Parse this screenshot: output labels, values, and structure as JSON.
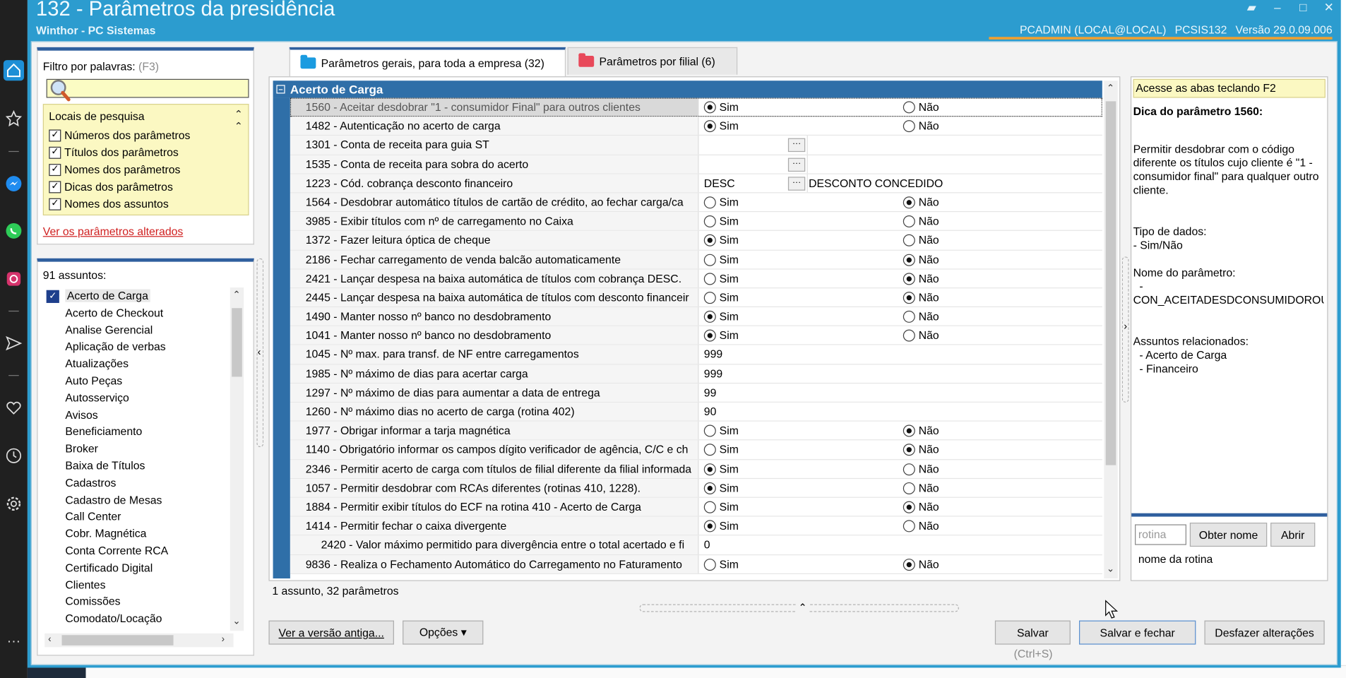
{
  "window": {
    "title": "132 - Parâmetros da presidência",
    "subtitle": "Winthor - PC Sistemas",
    "user": "PCADMIN (LOCAL@LOCAL)",
    "routine": "PCSIS132",
    "version": "Versão  29.0.09.006"
  },
  "filter": {
    "label": "Filtro por palavras:",
    "hint": "(F3)",
    "value": "",
    "locais_title": "Locais de pesquisa",
    "options": [
      {
        "label": "Números dos parâmetros",
        "checked": true
      },
      {
        "label": "Títulos dos parâmetros",
        "checked": true
      },
      {
        "label": "Nomes dos parâmetros",
        "checked": true
      },
      {
        "label": "Dicas dos parâmetros",
        "checked": true
      },
      {
        "label": "Nomes dos assuntos",
        "checked": true
      }
    ],
    "changed_link": "Ver os parâmetros alterados"
  },
  "assuntos": {
    "count_label": "91 assuntos:",
    "items": [
      "Acerto de Carga",
      "Acerto de Checkout",
      "Analise Gerencial",
      "Aplicação de verbas",
      "Atualizações",
      "Auto Peças",
      "Autosserviço",
      "Avisos",
      "Beneficiamento",
      "Broker",
      "Baixa de Títulos",
      "Cadastros",
      "Cadastro de Mesas",
      "Call Center",
      "Cobr. Magnética",
      "Conta Corrente RCA",
      "Certificado Digital",
      "Clientes",
      "Comissões",
      "Comodato/Locação"
    ]
  },
  "tabs": [
    {
      "label": "Parâmetros gerais, para toda a empresa  (32)",
      "color": "#1a9be0"
    },
    {
      "label": "Parâmetros por filial  (6)",
      "color": "#e8495a"
    }
  ],
  "grid": {
    "group": "Acerto de Carga",
    "sim": "Sim",
    "nao": "Não",
    "rows": [
      {
        "name": "1560 - Aceitar desdobrar \"1 - consumidor Final\" para outros clientes",
        "type": "radio",
        "value": "sim"
      },
      {
        "name": "1482 - Autenticação no acerto de carga",
        "type": "radio",
        "value": "sim"
      },
      {
        "name": "1301 - Conta de receita para guia ST",
        "type": "lookup",
        "code": "",
        "desc": ""
      },
      {
        "name": "1535 - Conta de receita para sobra do acerto",
        "type": "lookup",
        "code": "",
        "desc": ""
      },
      {
        "name": "1223 - Cód. cobrança desconto financeiro",
        "type": "lookup",
        "code": "DESC",
        "desc": "DESCONTO CONCEDIDO"
      },
      {
        "name": "1564 - Desdobrar automático títulos de cartão de crédito, ao fechar carga/ca",
        "type": "radio",
        "value": "nao"
      },
      {
        "name": "3985 - Exibir títulos com nº de carregamento no Caixa",
        "type": "radio",
        "value": ""
      },
      {
        "name": "1372 - Fazer leitura óptica de cheque",
        "type": "radio",
        "value": "sim"
      },
      {
        "name": "2186 - Fechar carregamento de venda balcão automaticamente",
        "type": "radio",
        "value": "nao"
      },
      {
        "name": "2421 - Lançar despesa na baixa automática de títulos com cobrança DESC.",
        "type": "radio",
        "value": "nao"
      },
      {
        "name": "2445 - Lançar despesa na baixa automática de títulos com desconto financeir",
        "type": "radio",
        "value": "nao"
      },
      {
        "name": "1490 - Manter nosso nº banco no desdobramento",
        "type": "radio",
        "value": "sim"
      },
      {
        "name": "1041 - Manter nosso nº banco no desdobramento",
        "type": "radio",
        "value": "sim"
      },
      {
        "name": "1045 - Nº max. para transf. de NF entre carregamentos",
        "type": "text",
        "value": "999"
      },
      {
        "name": "1985 - Nº máximo de dias para acertar carga",
        "type": "text",
        "value": "999"
      },
      {
        "name": "1297 - Nº máximo de dias para aumentar a data de entrega",
        "type": "text",
        "value": "99"
      },
      {
        "name": "1260 - Nº máximo dias no acerto de carga (rotina 402)",
        "type": "text",
        "value": "90"
      },
      {
        "name": "1977 - Obrigar informar a tarja magnética",
        "type": "radio",
        "value": "nao"
      },
      {
        "name": "1140 - Obrigatório informar os campos dígito verificador de agência, C/C e ch",
        "type": "radio",
        "value": "nao"
      },
      {
        "name": "2346 - Permitir acerto de carga com títulos de filial diferente da filial informada",
        "type": "radio",
        "value": "sim"
      },
      {
        "name": "1057 - Permitir desdobrar com RCAs diferentes (rotinas 410, 1228).",
        "type": "radio",
        "value": "sim"
      },
      {
        "name": "1884 - Permitir exibir títulos do ECF na rotina 410 - Acerto de Carga",
        "type": "radio",
        "value": "nao"
      },
      {
        "name": "1414 - Permitir fechar o caixa divergente",
        "type": "radio",
        "value": "sim"
      },
      {
        "name": "2420 - Valor máximo permitido para divergência entre o total acertado e fi",
        "type": "text",
        "value": "0",
        "indent": true
      },
      {
        "name": "9836 - Realiza o Fechamento Automático do Carregamento no Faturamento",
        "type": "radio",
        "value": "nao"
      }
    ],
    "status": "1 assunto, 32 parâmetros"
  },
  "help": {
    "tip": "Acesse as abas teclando F2",
    "title": "Dica do parâmetro 1560:",
    "description": "Permitir desdobrar com o código diferente os títulos cujo cliente é \"1 - consumidor final\" para qualquer outro cliente.",
    "tipo_label": "Tipo de dados:",
    "tipo_value": "  - Sim/Não",
    "nome_label": "Nome do parâmetro:",
    "nome_value": "  -\nCON_ACEITADESDCONSUMIDOROUT",
    "assuntos_label": "Assuntos relacionados:",
    "assuntos_value": "  - Acerto de Carga\n  - Financeiro",
    "rotina_placeholder": "rotina",
    "obter_nome": "Obter nome",
    "abrir": "Abrir",
    "nome_rotina": "nome da rotina"
  },
  "footer": {
    "versao_antiga": "Ver a versão antiga...",
    "opcoes": "Opções ▾",
    "salvar": "Salvar",
    "salvar_fechar": "Salvar e fechar",
    "desfazer": "Desfazer alterações",
    "shortcut": "(Ctrl+S)"
  }
}
